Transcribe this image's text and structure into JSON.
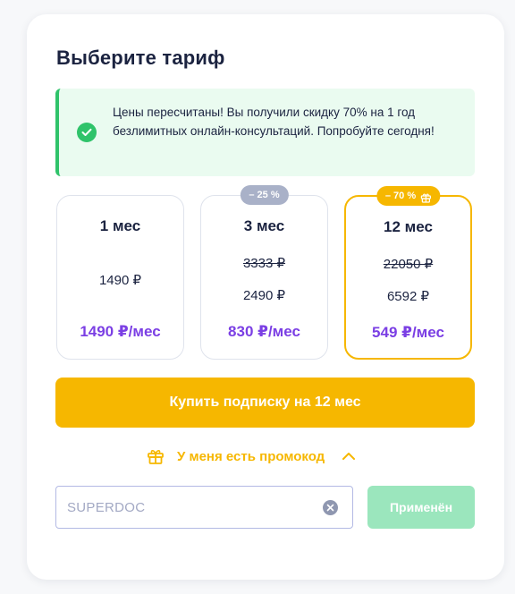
{
  "header": {
    "title": "Выберите тариф"
  },
  "notice": {
    "text": "Цены пересчитаны! Вы получили скидку 70% на 1 год безлимитных онлайн-консультаций. Попробуйте сегодня!"
  },
  "plans": [
    {
      "duration": "1 мес",
      "old_price": "",
      "price": "1490 ₽",
      "monthly": "1490 ₽/мес",
      "badge": "",
      "selected": false
    },
    {
      "duration": "3 мес",
      "old_price": "3333 ₽",
      "price": "2490 ₽",
      "monthly": "830 ₽/мес",
      "badge": "– 25 %",
      "selected": false
    },
    {
      "duration": "12 мес",
      "old_price": "22050 ₽",
      "price": "6592 ₽",
      "monthly": "549 ₽/мес",
      "badge": "– 70 %",
      "selected": true
    }
  ],
  "buy_button": {
    "label": "Купить подписку на 12 мес"
  },
  "promo": {
    "toggle_label": "У меня есть промокод",
    "value": "SUPERDOC",
    "apply_label": "Применён"
  },
  "colors": {
    "accent": "#f6b700",
    "price_purple": "#7b3fe4",
    "success_green": "#2fc36a",
    "notice_bg": "#eafbf0",
    "apply_green": "#9be6bd"
  },
  "icons": {
    "notice": "check-circle-icon",
    "badge_12": "gift-icon",
    "promo_toggle": "gift-icon",
    "promo_chevron": "chevron-up-icon",
    "input_clear": "clear-icon"
  }
}
